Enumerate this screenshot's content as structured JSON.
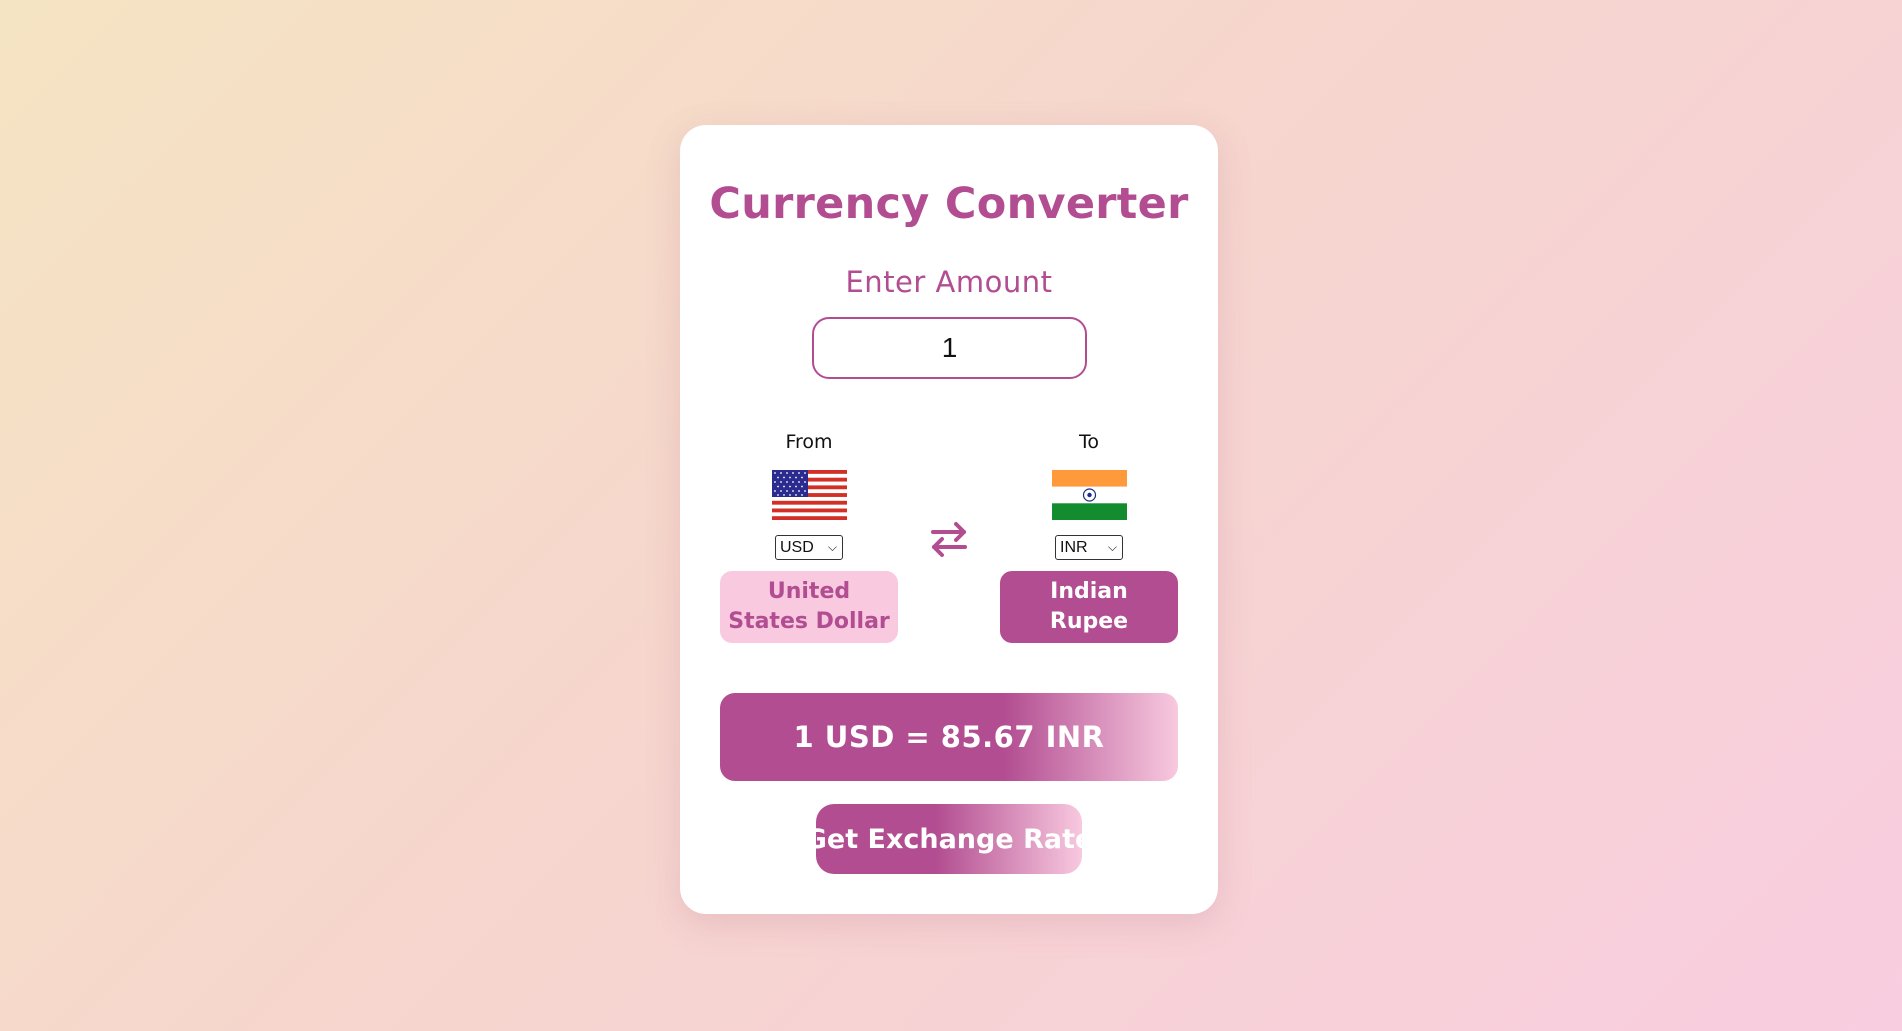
{
  "app": {
    "title": "Currency Converter",
    "amount_label": "Enter Amount",
    "amount_value": "1"
  },
  "from": {
    "label": "From",
    "flag_icon": "us-flag-icon",
    "currency_code": "USD",
    "currency_name": "United States Dollar"
  },
  "to": {
    "label": "To",
    "flag_icon": "india-flag-icon",
    "currency_code": "INR",
    "currency_name": "Indian Rupee"
  },
  "swap": {
    "icon": "swap-arrows-icon"
  },
  "result": {
    "text": "1 USD = 85.67 INR"
  },
  "actions": {
    "get_rate_label": "Get Exchange Rate"
  },
  "colors": {
    "accent": "#b24d91",
    "accent_light": "#f8c9df",
    "background_start": "#f5e4c3",
    "background_end": "#f8cde0"
  }
}
